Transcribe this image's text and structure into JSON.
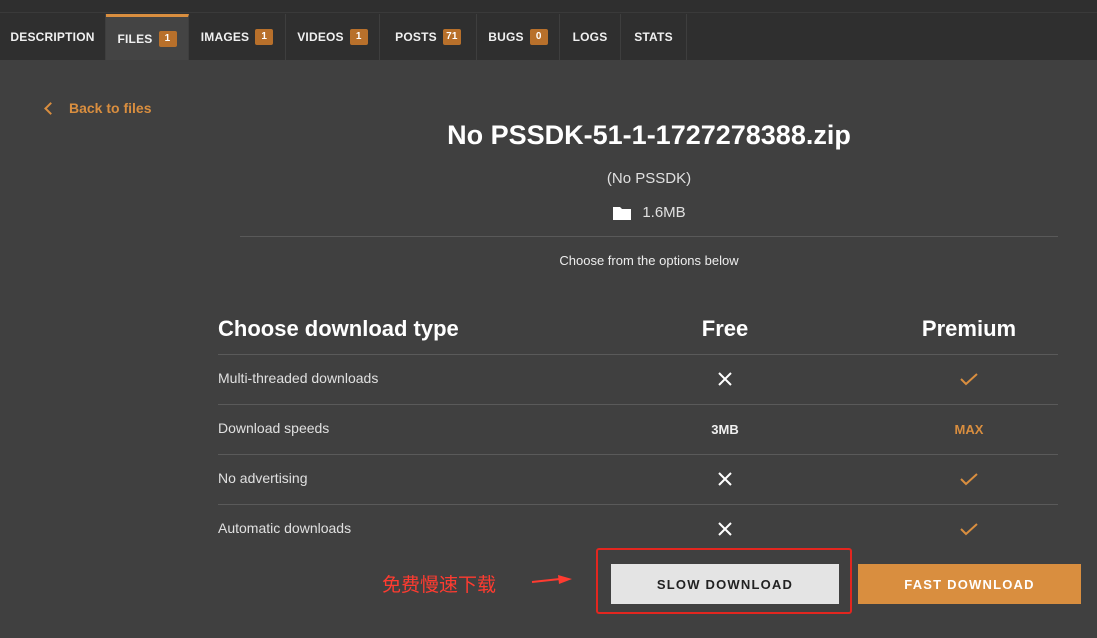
{
  "tabs": [
    {
      "label": "DESCRIPTION",
      "badge": ""
    },
    {
      "label": "FILES",
      "badge": "1",
      "active": true
    },
    {
      "label": "IMAGES",
      "badge": "1"
    },
    {
      "label": "VIDEOS",
      "badge": "1"
    },
    {
      "label": "POSTS",
      "badge": "71"
    },
    {
      "label": "BUGS",
      "badge": "0"
    },
    {
      "label": "LOGS",
      "badge": ""
    },
    {
      "label": "STATS",
      "badge": ""
    }
  ],
  "back_link": {
    "label": "Back to files",
    "icon": "chevron-left-icon"
  },
  "file": {
    "title": "No PSSDK-51-1-1727278388.zip",
    "subtitle": "(No PSSDK)",
    "size": "1.6MB",
    "size_icon": "folder-icon"
  },
  "choose_text": "Choose from the options below",
  "table": {
    "header": {
      "label": "Choose download type",
      "free": "Free",
      "premium": "Premium"
    },
    "rows": [
      {
        "label": "Multi-threaded downloads",
        "free": "cross",
        "premium": "check"
      },
      {
        "label": "Download speeds",
        "free": "3MB",
        "premium": "MAX"
      },
      {
        "label": "No advertising",
        "free": "cross",
        "premium": "check"
      },
      {
        "label": "Automatic downloads",
        "free": "cross",
        "premium": "check"
      }
    ]
  },
  "buttons": {
    "slow": "SLOW DOWNLOAD",
    "fast": "FAST DOWNLOAD"
  },
  "annotation": {
    "text": "免费慢速下载",
    "color": "#ff3b30"
  },
  "colors": {
    "accent": "#d98e3f",
    "background": "#404040",
    "tabbar": "#2f2f2f",
    "highlight": "#e3261f"
  }
}
